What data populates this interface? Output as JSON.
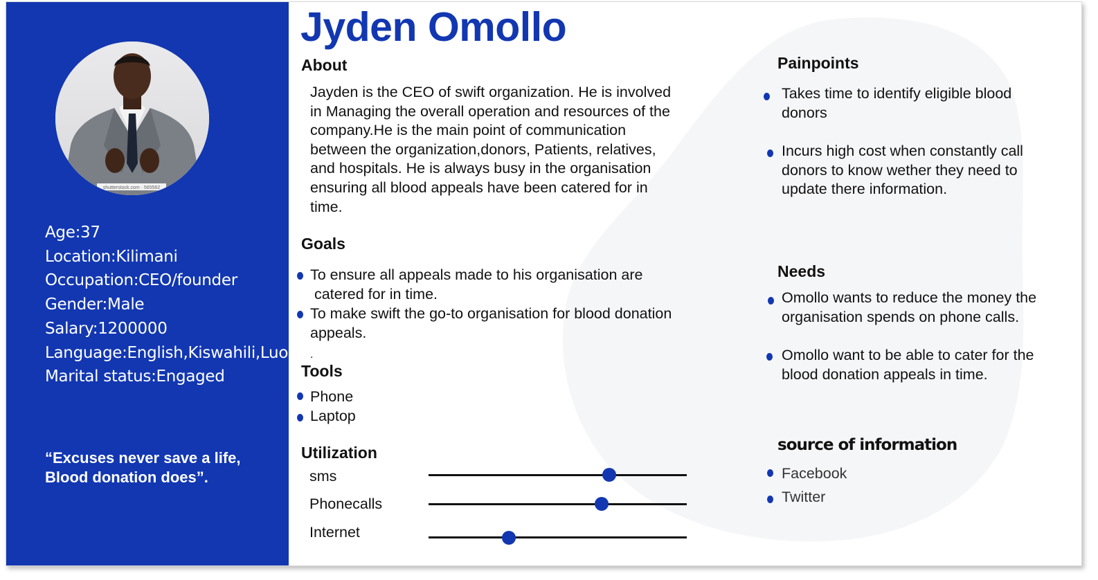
{
  "persona": {
    "name": "Jyden Omollo",
    "details": [
      "Age:37",
      "Location:Kilimani",
      "Occupation:CEO/founder",
      "Gender:Male",
      "Salary:1200000",
      "Language:English,Kiswahili,Luo",
      "Marital status:Engaged"
    ],
    "quote_line1": "“Excuses never save a life,",
    "quote_line2": "Blood donation does”.",
    "photo_watermark": "shutterstock.com · 565562"
  },
  "about": {
    "heading": "About",
    "lines": [
      "Jayden is the CEO of swift organization. He is involved",
      "in Managing the overall operation and resources of the",
      "company.He is the main point of communication",
      "between the organization,donors, Patients, relatives,",
      "and hospitals. He is always busy in the organisation",
      "ensuring all blood appeals have been catered for  in",
      "time."
    ]
  },
  "goals": {
    "heading": "Goals",
    "items": [
      {
        "line1": "To ensure all appeals made to his organisation are",
        "line2": " catered for in time."
      },
      {
        "line1": "To make swift the go-to organisation for blood donation",
        "line2": "appeals."
      }
    ],
    "trailing": "."
  },
  "tools": {
    "heading": "Tools",
    "items": [
      "Phone",
      "Laptop"
    ]
  },
  "utilization": {
    "heading": "Utilization",
    "items": [
      {
        "label": "sms",
        "level": 0.7
      },
      {
        "label": "Phonecalls",
        "level": 0.67
      },
      {
        "label": "Internet",
        "level": 0.31
      }
    ]
  },
  "painpoints": {
    "heading": "Painpoints",
    "items": [
      {
        "line1": "Takes time to identify eligible blood",
        "line2": "donors"
      },
      {
        "line1": "Incurs high cost when constantly call",
        "line2": "donors to know wether they need to",
        "line3": "update there information."
      }
    ]
  },
  "needs": {
    "heading": "Needs",
    "items": [
      {
        "line1": "Omollo wants to reduce the money the",
        "line2": "organisation spends on phone calls."
      },
      {
        "line1": "Omollo want to be able to cater for the",
        "line2": "blood donation appeals in time."
      }
    ]
  },
  "sources": {
    "heading": "source of information",
    "items": [
      "Facebook",
      "Twitter"
    ]
  },
  "colors": {
    "brand_blue": "#1237b1",
    "blob_gray": "#f5f6f8"
  }
}
